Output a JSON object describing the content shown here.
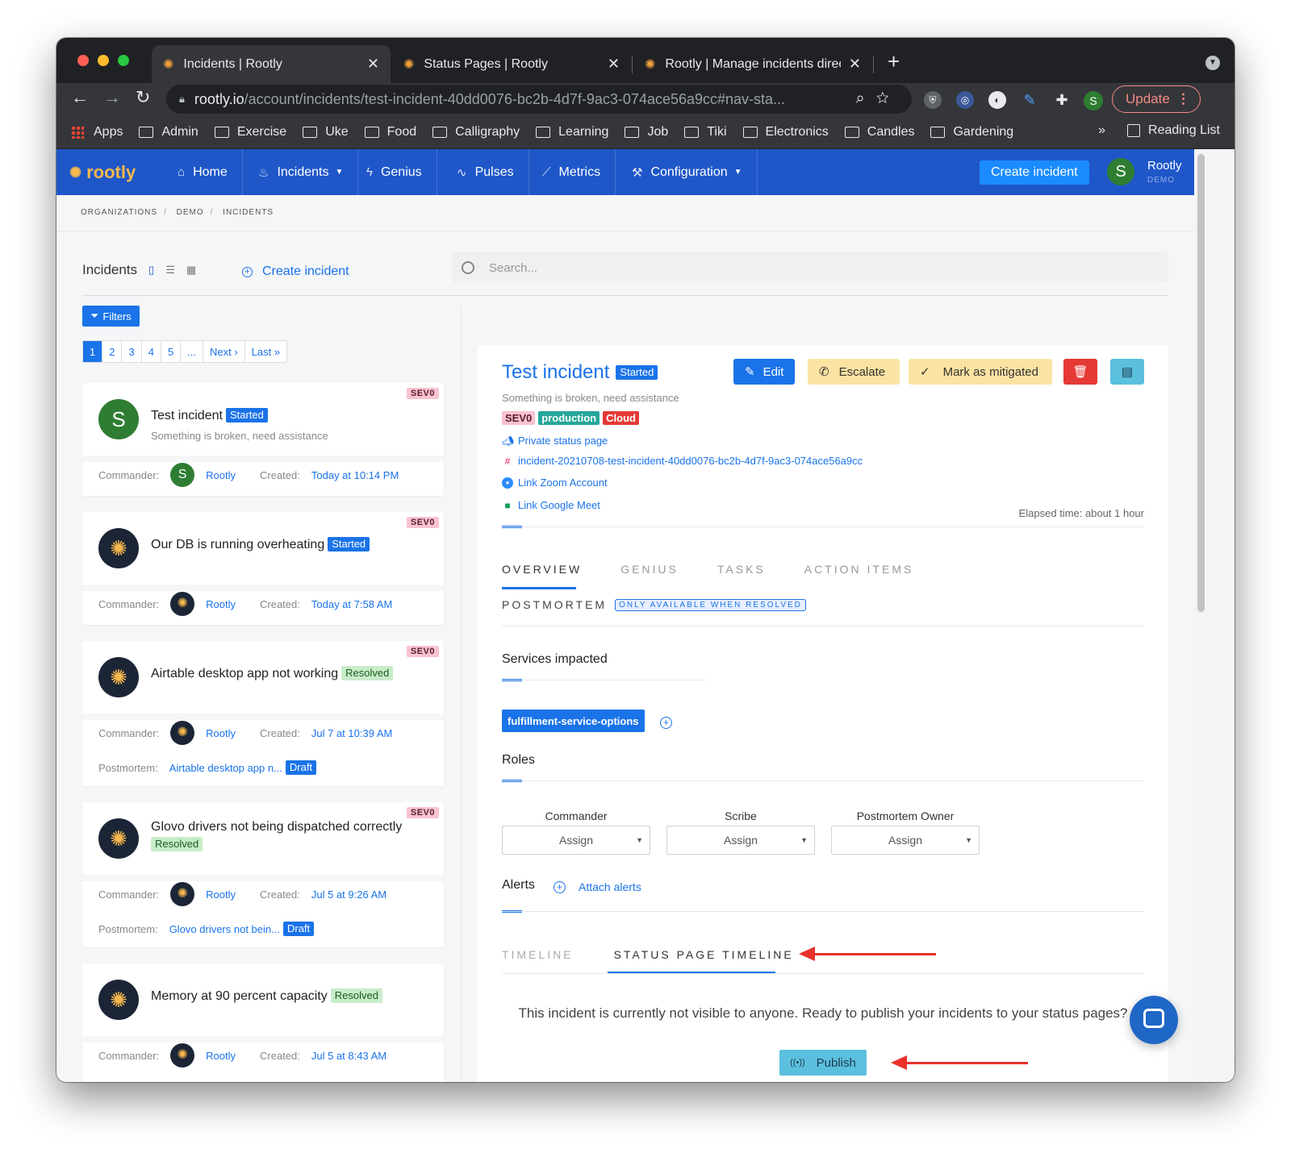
{
  "browser": {
    "tabs": [
      {
        "title": "Incidents | Rootly"
      },
      {
        "title": "Status Pages | Rootly"
      },
      {
        "title": "Rootly | Manage incidents direc"
      }
    ],
    "url_host": "rootly.io",
    "url_path": "/account/incidents/test-incident-40dd0076-bc2b-4d7f-9ac3-074ace56a9cc#nav-sta...",
    "profile_initial": "S",
    "update_label": "Update",
    "bookmarks": [
      "Apps",
      "Admin",
      "Exercise",
      "Uke",
      "Food",
      "Calligraphy",
      "Learning",
      "Job",
      "Tiki",
      "Electronics",
      "Candles",
      "Gardening"
    ],
    "bookmarks_more": "»",
    "reading_list": "Reading List"
  },
  "app": {
    "logo": "rootly",
    "nav": [
      {
        "label": "Home",
        "icon": "home-icon"
      },
      {
        "label": "Incidents",
        "icon": "flame-icon"
      },
      {
        "label": "Genius",
        "icon": "lightning-icon"
      },
      {
        "label": "Pulses",
        "icon": "pulse-icon"
      },
      {
        "label": "Metrics",
        "icon": "chart-icon"
      },
      {
        "label": "Configuration",
        "icon": "wrench-icon"
      }
    ],
    "create_incident": "Create incident",
    "user_initial": "S",
    "org_name": "Rootly",
    "org_sub": "DEMO"
  },
  "breadcrumb": [
    "ORGANIZATIONS",
    "DEMO",
    "INCIDENTS"
  ],
  "list": {
    "title": "Incidents",
    "create_link": "Create incident",
    "search_placeholder": "Search...",
    "filters": "Filters",
    "pages": [
      "1",
      "2",
      "3",
      "4",
      "5",
      "...",
      "Next ›",
      "Last »"
    ],
    "incidents": [
      {
        "title": "Test incident",
        "status": "Started",
        "sev": "SEV0",
        "desc": "Something is broken, need assistance",
        "commander_label": "Commander:",
        "commander": "Rootly",
        "created_label": "Created:",
        "created": "Today at 10:14 PM"
      },
      {
        "title": "Our DB is running overheating",
        "status": "Started",
        "sev": "SEV0",
        "commander_label": "Commander:",
        "commander": "Rootly",
        "created_label": "Created:",
        "created": "Today at 7:58 AM"
      },
      {
        "title": "Airtable desktop app not working",
        "status": "Resolved",
        "sev": "SEV0",
        "commander_label": "Commander:",
        "commander": "Rootly",
        "created_label": "Created:",
        "created": "Jul 7 at 10:39 AM",
        "postmortem_label": "Postmortem:",
        "postmortem": "Airtable desktop app n...",
        "postmortem_status": "Draft"
      },
      {
        "title": "Glovo drivers not being dispatched correctly",
        "status": "Resolved",
        "sev": "SEV0",
        "commander_label": "Commander:",
        "commander": "Rootly",
        "created_label": "Created:",
        "created": "Jul 5 at 9:26 AM",
        "postmortem_label": "Postmortem:",
        "postmortem": "Glovo drivers not bein...",
        "postmortem_status": "Draft"
      },
      {
        "title": "Memory at 90 percent capacity",
        "status": "Resolved",
        "commander_label": "Commander:",
        "commander": "Rootly",
        "created_label": "Created:",
        "created": "Jul 5 at 8:43 AM"
      }
    ]
  },
  "detail": {
    "title": "Test incident",
    "status": "Started",
    "buttons": {
      "edit": "Edit",
      "escalate": "Escalate",
      "mitigate": "Mark as mitigated"
    },
    "description": "Something is broken, need assistance",
    "tags": [
      {
        "label": "SEV0",
        "color": "#f9c3d1"
      },
      {
        "label": "production",
        "color": "#26a69a"
      },
      {
        "label": "Cloud",
        "color": "#e53935"
      }
    ],
    "links": {
      "status_page": "Private status page",
      "slack": "incident-20210708-test-incident-40dd0076-bc2b-4d7f-9ac3-074ace56a9cc",
      "zoom": "Link Zoom Account",
      "meet": "Link Google Meet"
    },
    "elapsed": "Elapsed time: about 1 hour",
    "tabs": [
      "OVERVIEW",
      "GENIUS",
      "TASKS",
      "ACTION ITEMS"
    ],
    "postmortem_tab": "POSTMORTEM",
    "postmortem_note": "ONLY AVAILABLE WHEN RESOLVED",
    "services_title": "Services impacted",
    "service": "fulfillment-service-options",
    "roles_title": "Roles",
    "roles": [
      {
        "label": "Commander",
        "value": "Assign"
      },
      {
        "label": "Scribe",
        "value": "Assign"
      },
      {
        "label": "Postmortem Owner",
        "value": "Assign"
      }
    ],
    "alerts_title": "Alerts",
    "attach_alerts": "Attach alerts",
    "timeline_tabs": [
      "TIMELINE",
      "STATUS PAGE TIMELINE"
    ],
    "notice": "This incident is currently not visible to anyone. Ready to publish your incidents to your status pages?",
    "publish": "Publish"
  },
  "colors": {
    "accent": "#1a73e8",
    "header": "#1f57c9",
    "arrow": "#e8322a",
    "publish": "#5bc0de"
  }
}
